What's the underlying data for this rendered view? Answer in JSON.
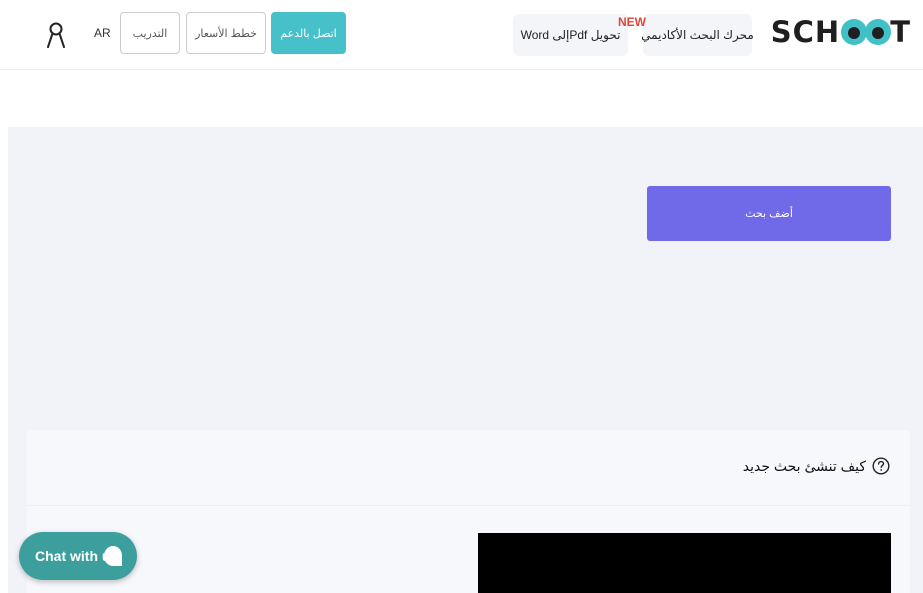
{
  "header": {
    "logo": {
      "text_left": "SCH",
      "text_right": "T",
      "brand_color": "#40c1c7"
    },
    "nav": {
      "academic_search": "محرك البحث الأكاديمي",
      "pdf_to_word": "تحويل Pdfإلى Word",
      "new_badge": "NEW"
    },
    "buttons": {
      "contact_support": "اتصل بالدعم",
      "pricing_plans": "خطط الأسعار",
      "training": "التدريب"
    },
    "language": "AR",
    "icons": {
      "user": "user-icon"
    }
  },
  "main": {
    "add_research_button": "أضف بحث",
    "accent_color": "#7069e8"
  },
  "card": {
    "title": "كيف تنشئ بحث جديد",
    "icon": "help-circle-icon"
  },
  "chat": {
    "label": "Chat with us",
    "icon": "chat-bubble-icon",
    "color": "#3d9f9d"
  }
}
